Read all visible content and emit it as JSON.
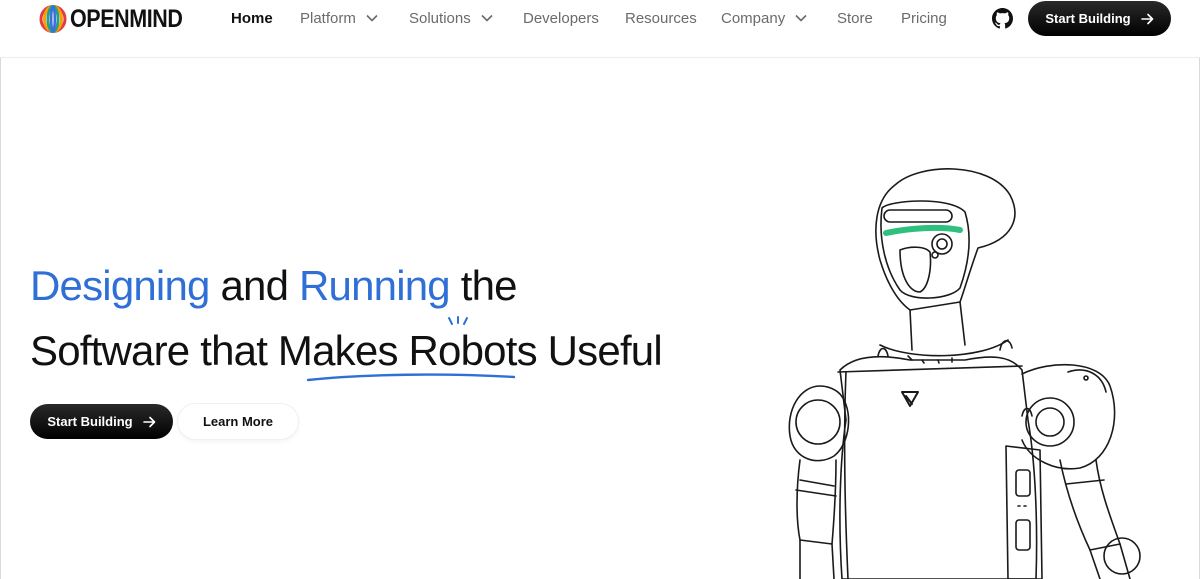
{
  "brand": {
    "name": "OPENMIND"
  },
  "nav": {
    "items": [
      {
        "label": "Home",
        "active": true,
        "dropdown": false
      },
      {
        "label": "Platform",
        "active": false,
        "dropdown": true
      },
      {
        "label": "Solutions",
        "active": false,
        "dropdown": true
      },
      {
        "label": "Developers",
        "active": false,
        "dropdown": false
      },
      {
        "label": "Resources",
        "active": false,
        "dropdown": false
      },
      {
        "label": "Company",
        "active": false,
        "dropdown": true
      },
      {
        "label": "Store",
        "active": false,
        "dropdown": false
      },
      {
        "label": "Pricing",
        "active": false,
        "dropdown": false
      }
    ],
    "github_icon": "github-icon",
    "cta_label": "Start Building"
  },
  "hero": {
    "line1": {
      "w1": "Designing",
      "w2": " and ",
      "w3": "Running",
      "w4": " the"
    },
    "line2": "Software that Makes Robots Useful",
    "primary_cta": "Start Building",
    "secondary_cta": "Learn More"
  },
  "colors": {
    "accent_blue": "#2f6fd6",
    "robot_visor": "#2fbf7f",
    "button_dark": "#000000"
  }
}
